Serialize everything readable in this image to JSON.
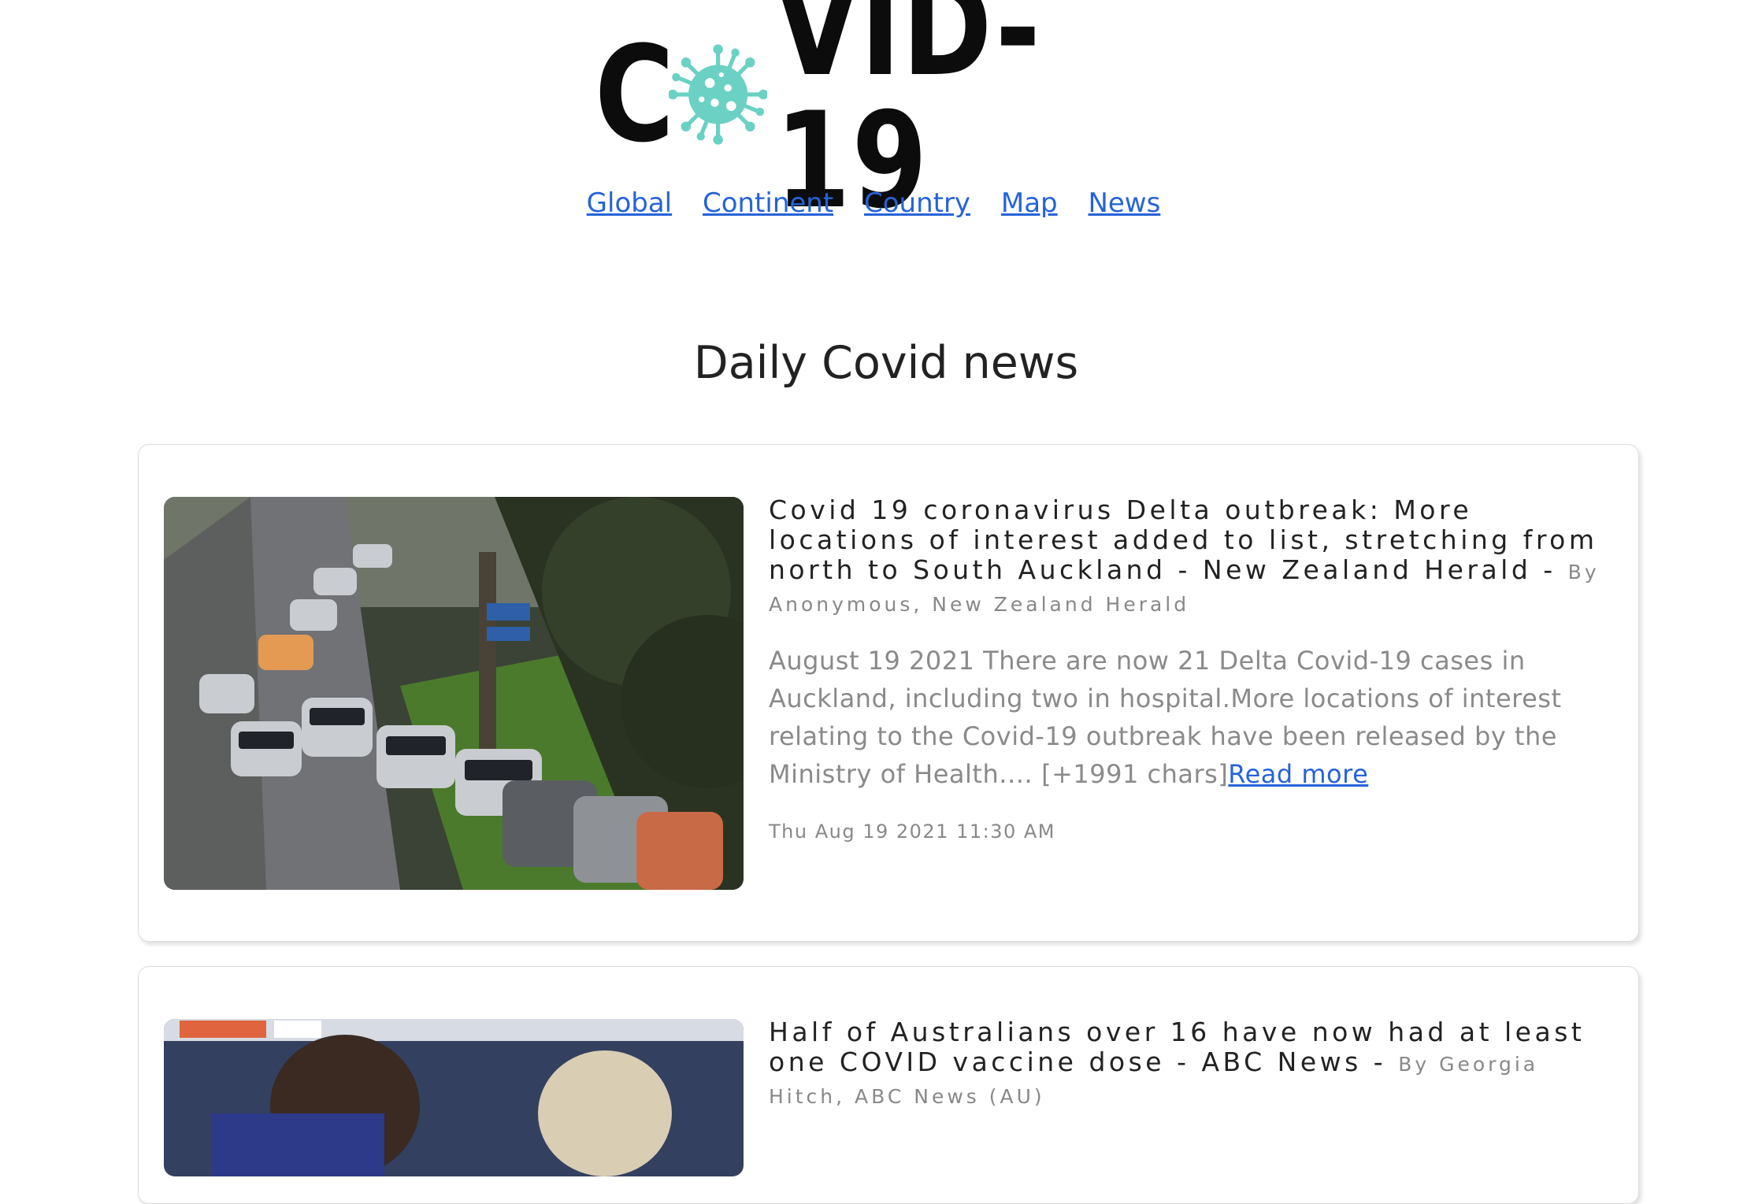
{
  "logo": {
    "c": "C",
    "rest": "VID-19",
    "virus_color": "#6ad1c4"
  },
  "nav": {
    "items": [
      "Global",
      "Continent",
      "Country",
      "Map",
      "News"
    ]
  },
  "page": {
    "heading": "Daily Covid news"
  },
  "articles": [
    {
      "title": "Covid 19 coronavirus Delta outbreak: More locations of interest added to list, stretching from north to South Auckland - New Zealand Herald - ",
      "byline": "By Anonymous, New Zealand Herald",
      "description": "August 19 2021 There are now 21 Delta Covid-19 cases in Auckland, including two in hospital.More locations of interest relating to the Covid-19 outbreak have been released by the Ministry of Health.… [+1991 chars]",
      "read_more": "Read more",
      "date": "Thu Aug 19 2021 11:30 AM",
      "image_icon": "cars-queue-photo"
    },
    {
      "title": "Half of Australians over 16 have now had at least one COVID vaccine dose - ABC News - ",
      "byline": "By Georgia Hitch, ABC News (AU)",
      "image_icon": "vaccination-photo"
    }
  ],
  "colors": {
    "link": "#2663d8",
    "muted": "#8a8a8a",
    "text": "#222222"
  }
}
